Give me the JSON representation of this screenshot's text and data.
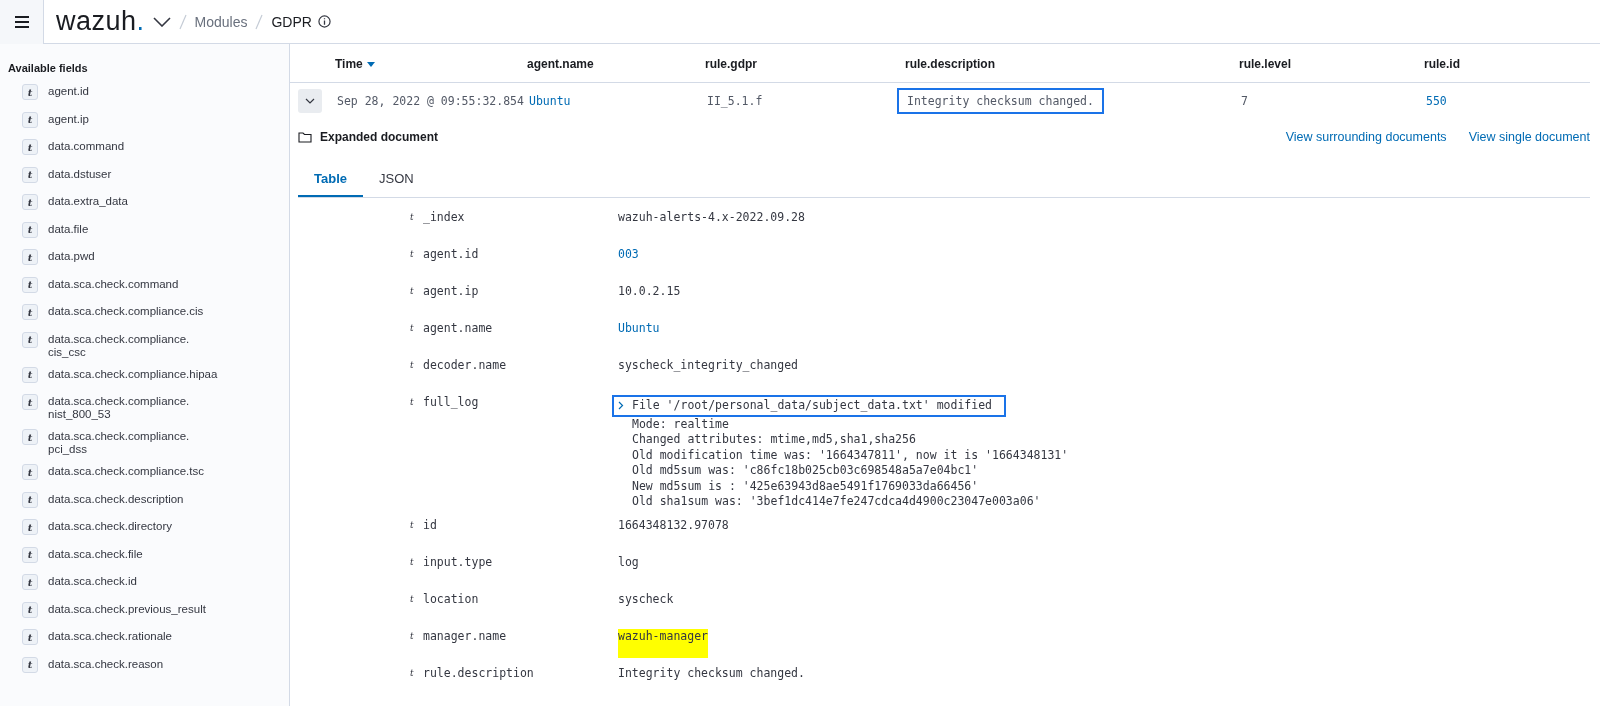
{
  "header": {
    "logo": "wazuh",
    "logo_mark": ".",
    "breadcrumbs": [
      {
        "label": "Modules",
        "current": false
      },
      {
        "label": "GDPR",
        "current": true
      }
    ]
  },
  "sidebar": {
    "section_title": "Available fields",
    "fields": [
      {
        "type": "t",
        "name": "agent.id"
      },
      {
        "type": "t",
        "name": "agent.ip"
      },
      {
        "type": "t",
        "name": "data.command"
      },
      {
        "type": "t",
        "name": "data.dstuser"
      },
      {
        "type": "t",
        "name": "data.extra_data"
      },
      {
        "type": "t",
        "name": "data.file"
      },
      {
        "type": "t",
        "name": "data.pwd"
      },
      {
        "type": "t",
        "name": "data.sca.check.command"
      },
      {
        "type": "t",
        "name": "data.sca.check.compliance.cis"
      },
      {
        "type": "t",
        "name": "data.sca.check.compliance.\ncis_csc"
      },
      {
        "type": "t",
        "name": "data.sca.check.compliance.hipaa"
      },
      {
        "type": "t",
        "name": "data.sca.check.compliance.\nnist_800_53"
      },
      {
        "type": "t",
        "name": "data.sca.check.compliance.\npci_dss"
      },
      {
        "type": "t",
        "name": "data.sca.check.compliance.tsc"
      },
      {
        "type": "t",
        "name": "data.sca.check.description"
      },
      {
        "type": "t",
        "name": "data.sca.check.directory"
      },
      {
        "type": "t",
        "name": "data.sca.check.file"
      },
      {
        "type": "t",
        "name": "data.sca.check.id"
      },
      {
        "type": "t",
        "name": "data.sca.check.previous_result"
      },
      {
        "type": "t",
        "name": "data.sca.check.rationale"
      },
      {
        "type": "t",
        "name": "data.sca.check.reason"
      }
    ]
  },
  "table": {
    "columns": [
      {
        "label": "Time",
        "sorted": true
      },
      {
        "label": "agent.name",
        "sorted": false
      },
      {
        "label": "rule.gdpr",
        "sorted": false
      },
      {
        "label": "rule.description",
        "sorted": false
      },
      {
        "label": "rule.level",
        "sorted": false
      },
      {
        "label": "rule.id",
        "sorted": false
      }
    ],
    "rows": [
      {
        "expanded": true,
        "cells": [
          {
            "text": "Sep 28, 2022 @ 09:55:32.854",
            "link": false,
            "outlined": false
          },
          {
            "text": "Ubuntu",
            "link": true,
            "outlined": false
          },
          {
            "text": "II_5.1.f",
            "link": false,
            "outlined": false
          },
          {
            "text": "Integrity checksum changed.",
            "link": false,
            "outlined": true
          },
          {
            "text": "7",
            "link": false,
            "outlined": false
          },
          {
            "text": "550",
            "link": true,
            "outlined": false
          }
        ]
      }
    ]
  },
  "document": {
    "title": "Expanded document",
    "links": [
      "View surrounding documents",
      "View single document"
    ],
    "tabs": [
      {
        "label": "Table",
        "selected": true
      },
      {
        "label": "JSON",
        "selected": false
      }
    ],
    "fields": [
      {
        "type": "t",
        "name": "_index",
        "value": "wazuh-alerts-4.x-2022.09.28",
        "link": false,
        "highlighted": false
      },
      {
        "type": "t",
        "name": "agent.id",
        "value": "003",
        "link": true,
        "highlighted": false
      },
      {
        "type": "t",
        "name": "agent.ip",
        "value": "10.0.2.15",
        "link": false,
        "highlighted": false
      },
      {
        "type": "t",
        "name": "agent.name",
        "value": "Ubuntu",
        "link": true,
        "highlighted": false
      },
      {
        "type": "t",
        "name": "decoder.name",
        "value": "syscheck_integrity_changed",
        "link": false,
        "highlighted": false
      },
      {
        "type": "t",
        "name": "full_log",
        "kind": "log",
        "first_line": "File '/root/personal_data/subject_data.txt' modified",
        "first_line_outlined": true,
        "lines": [
          "Mode: realtime",
          "Changed attributes: mtime,md5,sha1,sha256",
          "Old modification time was: '1664347811', now it is '1664348131'",
          "Old md5sum was: 'c86fc18b025cb03c698548a5a7e04bc1'",
          "New md5sum is : '425e63943d8ae5491f1769033da66456'",
          "Old sha1sum was: '3bef1dc414e7fe247cdca4d4900c23047e003a06'"
        ]
      },
      {
        "type": "t",
        "name": "id",
        "value": "1664348132.97078",
        "link": false,
        "highlighted": false
      },
      {
        "type": "t",
        "name": "input.type",
        "value": "log",
        "link": false,
        "highlighted": false
      },
      {
        "type": "t",
        "name": "location",
        "value": "syscheck",
        "link": false,
        "highlighted": false
      },
      {
        "type": "t",
        "name": "manager.name",
        "value": "wazuh-manager",
        "link": false,
        "highlighted": true
      },
      {
        "type": "t",
        "name": "rule.description",
        "value": "Integrity checksum changed.",
        "link": false,
        "highlighted": false
      }
    ]
  }
}
